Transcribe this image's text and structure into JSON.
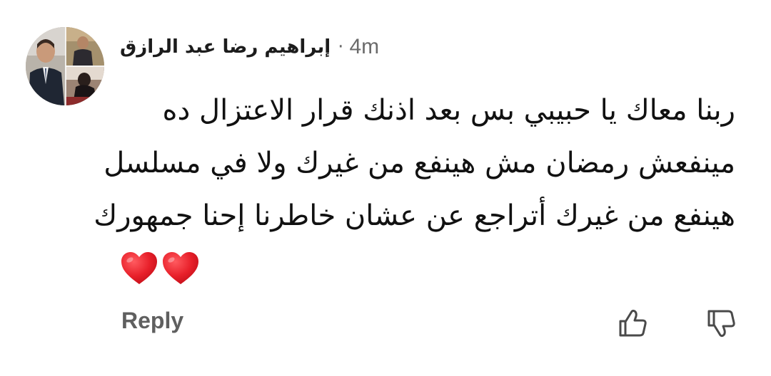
{
  "comment": {
    "author": "إبراهيم رضا عبد الرازق",
    "separator": "·",
    "time": "4m",
    "body_lines": [
      "ربنا معاك يا حبيبي بس بعد اذنك قرار الاعتزال ده",
      "مينفعش رمضان مش هينفع من غيرك ولا في مسلسل",
      "هينفع من غيرك أتراجع عن عشان خاطرنا إحنا جمهورك"
    ],
    "emoji": [
      "heart",
      "heart"
    ],
    "reply_label": "Reply",
    "icons": {
      "like": "thumbs-up-icon",
      "dislike": "thumbs-down-icon"
    },
    "colors": {
      "heart": "#e8202a",
      "secondary_text": "#6b6b6b"
    }
  }
}
